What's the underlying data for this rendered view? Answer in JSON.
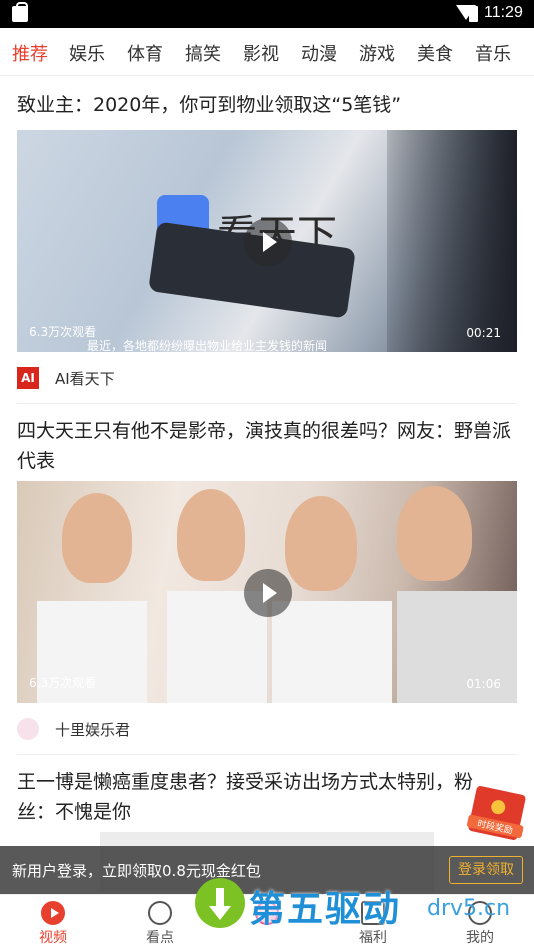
{
  "status_bar": {
    "time": "11:29"
  },
  "tabs": [
    "推荐",
    "娱乐",
    "体育",
    "搞笑",
    "影视",
    "动漫",
    "游戏",
    "美食",
    "音乐"
  ],
  "active_tab": 0,
  "articles": [
    {
      "title": "致业主：2020年，你可到物业领取这“5笔钱”",
      "views": "6.3万次观看",
      "duration": "00:21",
      "video_caption": "最近，各地都纷纷曝出物业给业主发钱的新闻",
      "thumb_text": "看天下",
      "source_icon": "AI",
      "source": "AI看天下"
    },
    {
      "title": "四大天王只有他不是影帝，演技真的很差吗？网友：野兽派代表",
      "views": "6.3万次观看",
      "duration": "01:06",
      "source": "十里娱乐君"
    },
    {
      "title": "王一博是懒癌重度患者？接受采访出场方式太特别，粉丝：不愧是你"
    }
  ],
  "promo": {
    "text": "新用户登录，立即领取0.8元现金红包",
    "button": "登录领取"
  },
  "red_envelope": {
    "label": "时段奖励"
  },
  "bottom_nav": [
    {
      "label": "视频",
      "icon": "play-icon"
    },
    {
      "label": "看点",
      "icon": "hash-icon"
    },
    {
      "label": "",
      "icon": "center-icon"
    },
    {
      "label": "福利",
      "icon": "gift-icon"
    },
    {
      "label": "我的",
      "icon": "user-icon"
    }
  ],
  "watermark": {
    "text": "第五驱动",
    "url": "drv5.cn"
  }
}
